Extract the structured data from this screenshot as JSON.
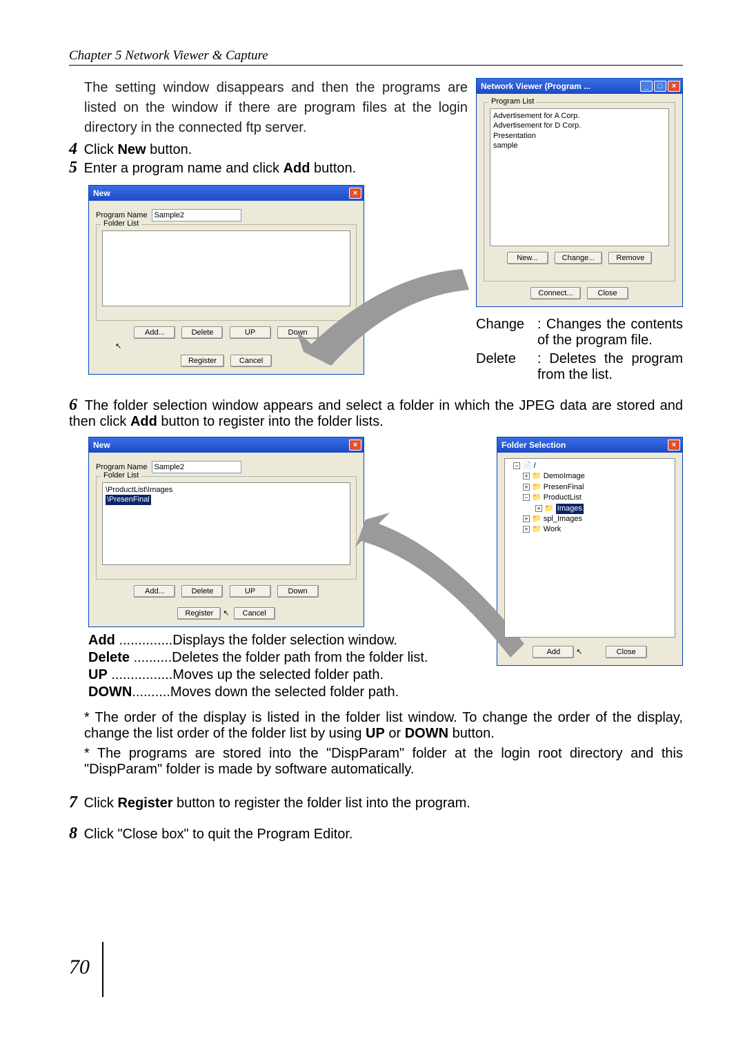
{
  "chapter": "Chapter 5 Network Viewer & Capture",
  "intro": "The setting window disappears and then the programs are listed on the window if there are program files at the login directory in the connected ftp server.",
  "step4_pre": "Click ",
  "step4_bold": "New",
  "step4_post": " button.",
  "step5_pre": "Enter a program name and click ",
  "step5_bold": "Add",
  "step5_post": " button.",
  "step6_pre": "The folder selection window appears and select a folder in which the JPEG data are stored and then click ",
  "step6_bold": "Add",
  "step6_post": " button to register into the folder lists.",
  "step7_pre": "Click ",
  "step7_bold": "Register",
  "step7_post": " button to register the folder list into the program.",
  "step8": "Click \"Close box\" to quit the Program Editor.",
  "labels": {
    "change_key": "Change",
    "change_val": ": Changes the contents of the program file.",
    "delete_key": "Delete",
    "delete_val": ": Deletes the program from the list."
  },
  "bullets": {
    "add": {
      "k": "Add",
      "dots": " ..............",
      "v": "Displays the folder selection window."
    },
    "del": {
      "k": "Delete",
      "dots": " ..........",
      "v": "Deletes the folder path from the folder list."
    },
    "up": {
      "k": "UP",
      "dots": " ................",
      "v": "Moves up the selected folder path."
    },
    "dn": {
      "k": "DOWN",
      "dots": "..........",
      "v": "Moves down the selected folder path."
    }
  },
  "notes": {
    "n1_a": "* The order of the display is listed in the folder list window. To change the order of the display, change the list order of the folder list by using ",
    "n1_b": "UP",
    "n1_c": " or ",
    "n1_d": "DOWN",
    "n1_e": " button.",
    "n2": "* The programs are stored into the \"DispParam\" folder  at the login root directory and this \"DispParam\" folder is made by software automatically."
  },
  "win_viewer": {
    "title": "Network Viewer (Program ...",
    "group": "Program List",
    "items": [
      "Advertisement for A Corp.",
      "Advertisement for D Corp.",
      "Presentation",
      "sample"
    ],
    "btn_new": "New...",
    "btn_change": "Change...",
    "btn_remove": "Remove",
    "btn_connect": "Connect...",
    "btn_close": "Close"
  },
  "win_new": {
    "title": "New",
    "lbl_program": "Program Name",
    "program_val": "Sample2",
    "group_folder": "Folder List",
    "btn_add": "Add...",
    "btn_del": "Delete",
    "btn_up": "UP",
    "btn_down": "Down",
    "btn_reg": "Register",
    "btn_cancel": "Cancel",
    "folders": [
      "\\ProductList\\Images",
      "\\PresenFinal"
    ]
  },
  "win_folder": {
    "title": "Folder Selection",
    "tree_root": "/",
    "tree": [
      "DemoImage",
      "PresenFinal",
      "ProductList",
      "Images",
      "spl_Images",
      "Work"
    ],
    "btn_add": "Add",
    "btn_close": "Close"
  },
  "page_num": "70"
}
